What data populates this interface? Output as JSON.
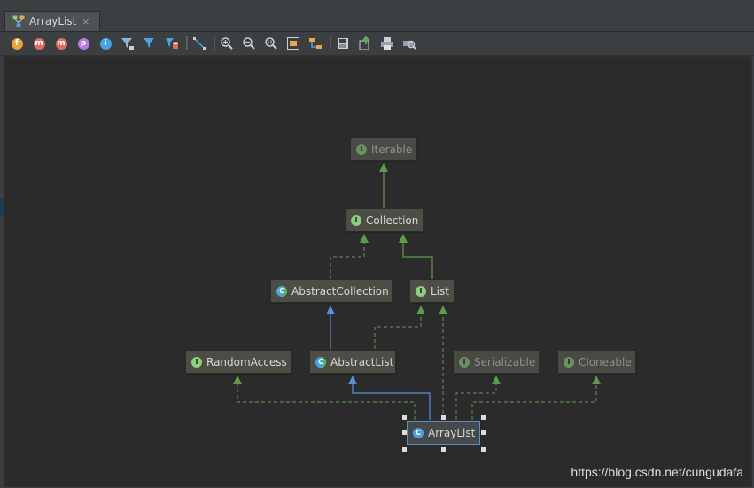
{
  "tab": {
    "title": "ArrayList",
    "close": "×"
  },
  "toolbar": {
    "fields_label": "f",
    "methods_label": "m",
    "methods2_label": "m",
    "properties_label": "p",
    "info_label": "i"
  },
  "diagram": {
    "nodes": {
      "iterable": {
        "label": "Iterable",
        "kind": "I"
      },
      "collection": {
        "label": "Collection",
        "kind": "I"
      },
      "abstract_collection": {
        "label": "AbstractCollection",
        "kind": "C"
      },
      "list": {
        "label": "List",
        "kind": "I"
      },
      "random_access": {
        "label": "RandomAccess",
        "kind": "I"
      },
      "abstract_list": {
        "label": "AbstractList",
        "kind": "C"
      },
      "serializable": {
        "label": "Serializable",
        "kind": "I"
      },
      "cloneable": {
        "label": "Cloneable",
        "kind": "I"
      },
      "array_list": {
        "label": "ArrayList",
        "kind": "C"
      }
    }
  },
  "watermark": "https://blog.csdn.net/cungudafa",
  "colors": {
    "implements_edge": "#5f9b4c",
    "extends_edge": "#5b8fe0",
    "selection": "#5a8fc8"
  }
}
